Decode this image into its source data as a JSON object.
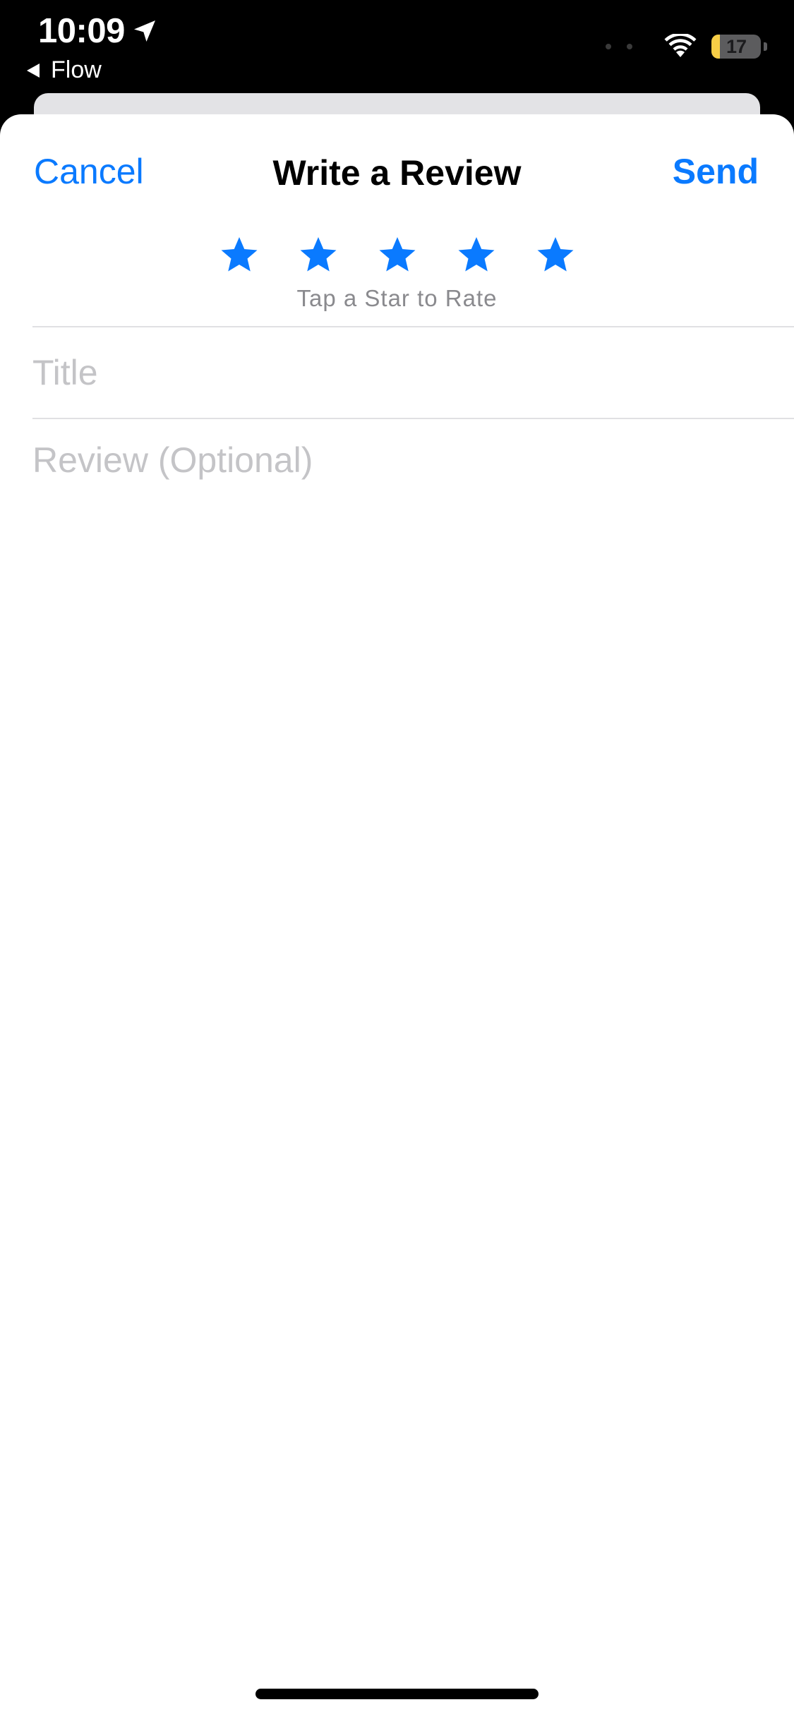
{
  "status_bar": {
    "time": "10:09",
    "back_app": "Flow",
    "battery_level": "17",
    "battery_fraction": 0.17,
    "icons": [
      "location-arrow-icon",
      "back-triangle-icon",
      "signal-dots-icon",
      "wifi-icon",
      "battery-icon"
    ]
  },
  "sheet": {
    "title": "Write a Review",
    "cancel_label": "Cancel",
    "send_label": "Send"
  },
  "rating": {
    "star_count": 5,
    "hint": "Tap a Star to Rate"
  },
  "form": {
    "title_value": "",
    "title_placeholder": "Title",
    "review_value": "",
    "review_placeholder": "Review (Optional)"
  },
  "colors": {
    "accent": "#0a7aff",
    "placeholder": "#c4c4c7",
    "hint": "#8a8a8e",
    "battery_fill": "#f7ce46"
  }
}
